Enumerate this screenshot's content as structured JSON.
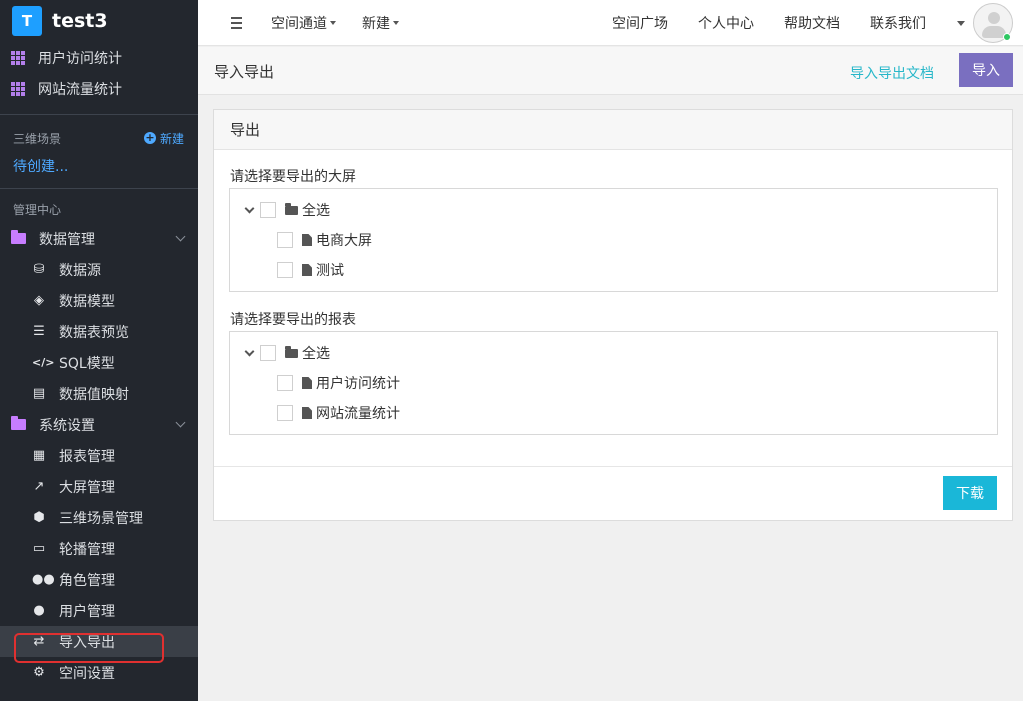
{
  "brand": {
    "logo_letter": "T",
    "name": "test3"
  },
  "sidebar": {
    "top_items": [
      {
        "label": "用户访问统计",
        "icon": "grid-icon"
      },
      {
        "label": "网站流量统计",
        "icon": "grid-icon"
      }
    ],
    "scenes": {
      "label": "三维场景",
      "new_label": "新建",
      "pending": "待创建..."
    },
    "admin": {
      "label": "管理中心",
      "data_group": {
        "label": "数据管理",
        "items": [
          {
            "label": "数据源",
            "icon": "database-icon"
          },
          {
            "label": "数据模型",
            "icon": "cubes-icon"
          },
          {
            "label": "数据表预览",
            "icon": "list-icon"
          },
          {
            "label": "SQL模型",
            "icon": "code-icon"
          },
          {
            "label": "数据值映射",
            "icon": "book-icon"
          }
        ]
      },
      "system_group": {
        "label": "系统设置",
        "items": [
          {
            "label": "报表管理",
            "icon": "grid-icon"
          },
          {
            "label": "大屏管理",
            "icon": "chart-line-icon"
          },
          {
            "label": "三维场景管理",
            "icon": "cube-icon"
          },
          {
            "label": "轮播管理",
            "icon": "monitor-icon"
          },
          {
            "label": "角色管理",
            "icon": "users-icon"
          },
          {
            "label": "用户管理",
            "icon": "user-icon"
          },
          {
            "label": "导入导出",
            "icon": "exchange-icon",
            "active": true
          },
          {
            "label": "空间设置",
            "icon": "gear-icon"
          }
        ]
      }
    }
  },
  "topbar": {
    "menu": [
      {
        "label": "空间通道"
      },
      {
        "label": "新建"
      }
    ],
    "right": [
      "空间广场",
      "个人中心",
      "帮助文档",
      "联系我们"
    ]
  },
  "page": {
    "title": "导入导出",
    "doc_link": "导入导出文档",
    "import_btn": "导入"
  },
  "panel": {
    "title": "导出",
    "screens": {
      "label": "请选择要导出的大屏",
      "root": "全选",
      "items": [
        "电商大屏",
        "测试"
      ]
    },
    "reports": {
      "label": "请选择要导出的报表",
      "root": "全选",
      "items": [
        "用户访问统计",
        "网站流量统计"
      ]
    },
    "download_btn": "下载"
  },
  "colors": {
    "sidebar_bg": "#23272e",
    "brand": "#1e9fff",
    "link": "#27b7c9",
    "import_btn": "#7a6fc0",
    "download_btn": "#1ab7d8",
    "active_outline": "#e03030"
  }
}
